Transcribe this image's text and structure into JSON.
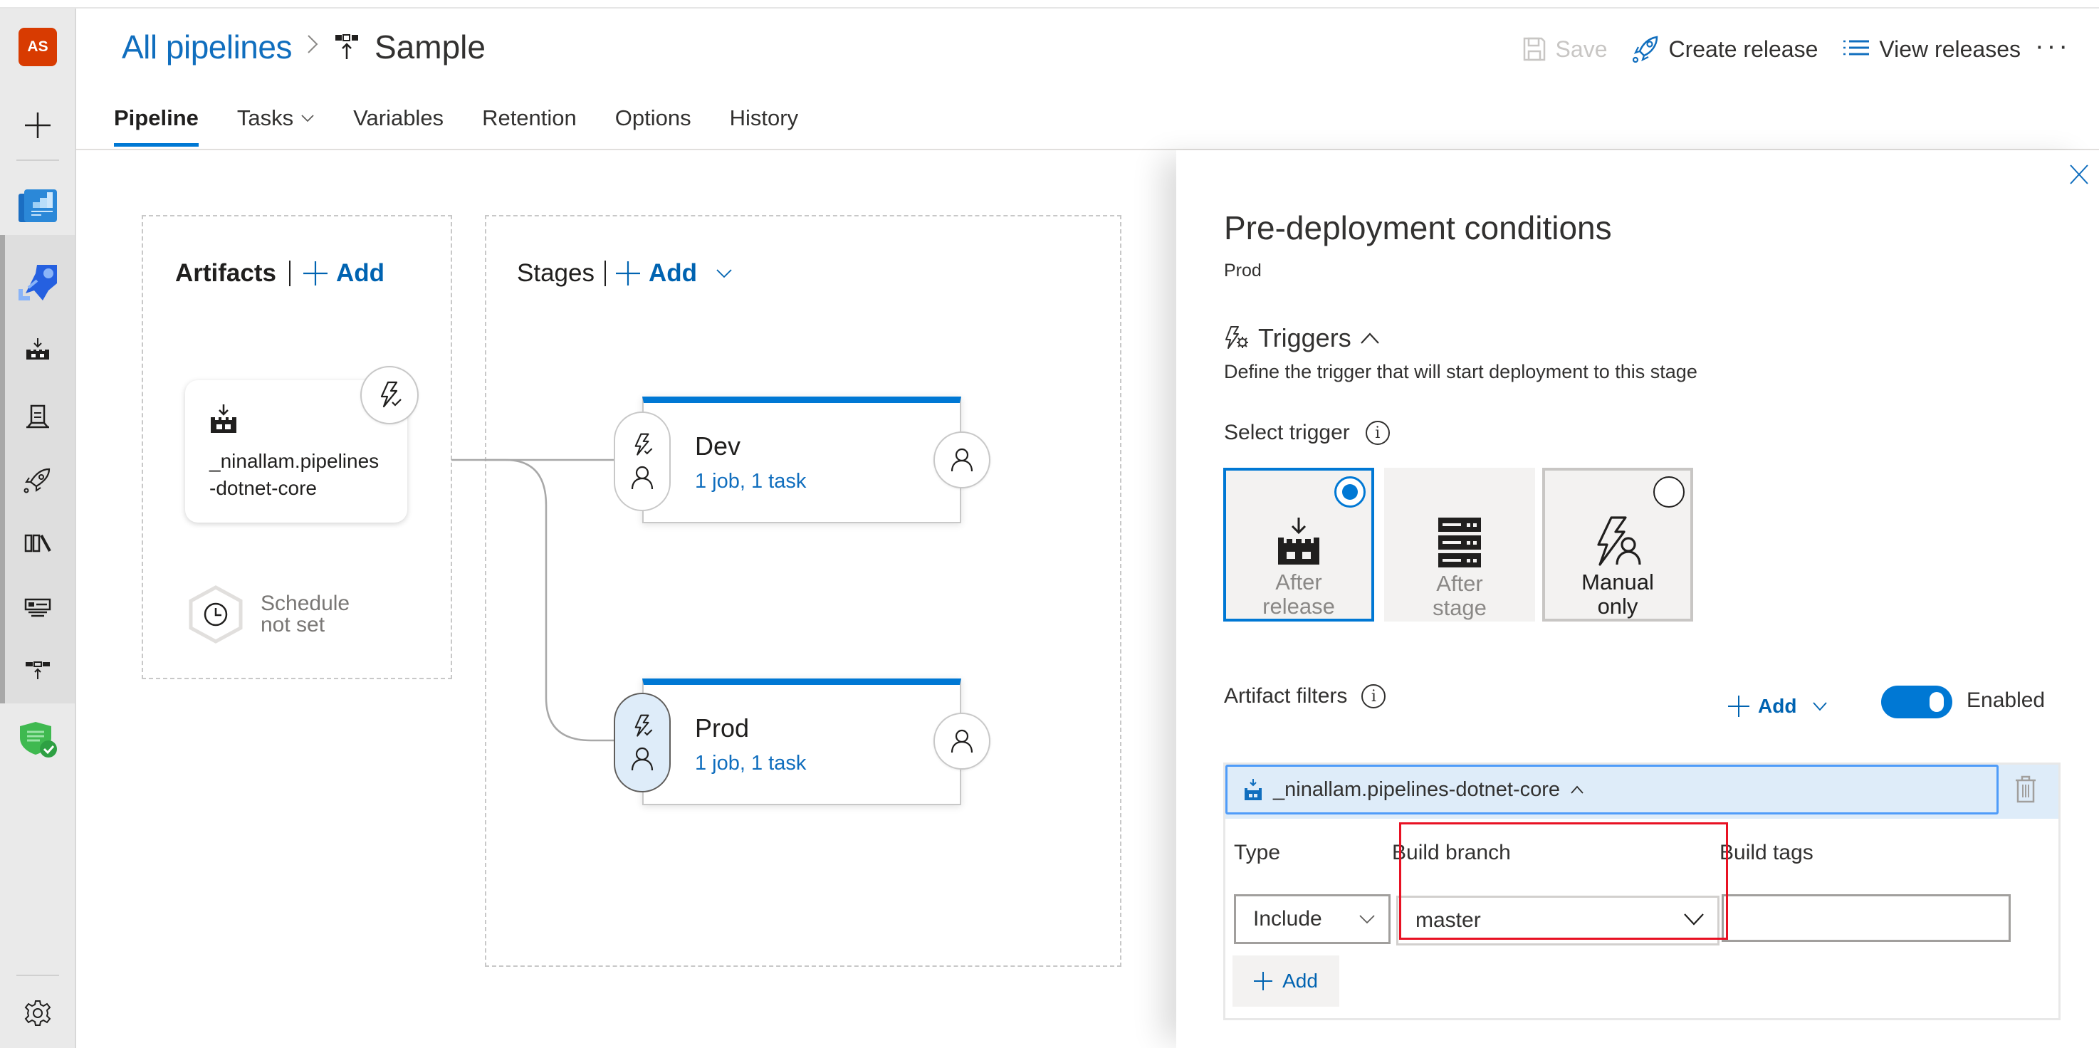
{
  "sidebar": {
    "avatar_initials": "AS",
    "items": [
      {
        "name": "new-icon"
      },
      {
        "name": "overview-icon"
      },
      {
        "name": "pipelines-icon",
        "selected": true
      },
      {
        "name": "builds-icon"
      },
      {
        "name": "environments-icon"
      },
      {
        "name": "releases-icon"
      },
      {
        "name": "library-icon"
      },
      {
        "name": "task-groups-icon"
      },
      {
        "name": "deployment-groups-icon"
      },
      {
        "name": "security-icon"
      }
    ],
    "settings_icon": "gear-icon"
  },
  "header": {
    "breadcrumb_root": "All pipelines",
    "breadcrumb_separator": ">",
    "title": "Sample",
    "toolbar": {
      "save_label": "Save",
      "create_release_label": "Create release",
      "view_releases_label": "View releases",
      "more_label": "···"
    },
    "tabs": [
      {
        "label": "Pipeline",
        "active": true
      },
      {
        "label": "Tasks",
        "dropdown": true
      },
      {
        "label": "Variables"
      },
      {
        "label": "Retention"
      },
      {
        "label": "Options"
      },
      {
        "label": "History"
      }
    ]
  },
  "canvas": {
    "artifacts": {
      "heading": "Artifacts",
      "add_label": "Add",
      "artifact_name_line1": "_ninallam.pipelines",
      "artifact_name_line2": "-dotnet-core",
      "schedule_line1": "Schedule",
      "schedule_line2": "not set"
    },
    "stages": {
      "heading": "Stages",
      "add_label": "Add",
      "items": [
        {
          "name": "Dev",
          "summary": "1 job, 1 task",
          "selected": false
        },
        {
          "name": "Prod",
          "summary": "1 job, 1 task",
          "selected": true
        }
      ]
    }
  },
  "panel": {
    "title": "Pre-deployment conditions",
    "subtitle": "Prod",
    "triggers": {
      "heading": "Triggers",
      "description": "Define the trigger that will start deployment to this stage",
      "select_label": "Select trigger",
      "options": [
        {
          "line1": "After",
          "line2": "release",
          "selected": true
        },
        {
          "line1": "After",
          "line2": "stage",
          "selected": false
        },
        {
          "line1": "Manual",
          "line2": "only",
          "selected": false
        }
      ]
    },
    "artifact_filters": {
      "heading": "Artifact filters",
      "add_label": "Add",
      "toggle_label": "Enabled",
      "toggle_on": true,
      "artifact": "_ninallam.pipelines-dotnet-core",
      "type_label": "Type",
      "type_value": "Include",
      "branch_label": "Build branch",
      "branch_value": "master",
      "tags_label": "Build tags",
      "tags_value": "",
      "add_filter_label": "Add"
    },
    "colors": {
      "accent": "#0078d4",
      "link": "#106ebe",
      "highlight": "#e81123",
      "selected_bg": "#deecf9"
    }
  }
}
